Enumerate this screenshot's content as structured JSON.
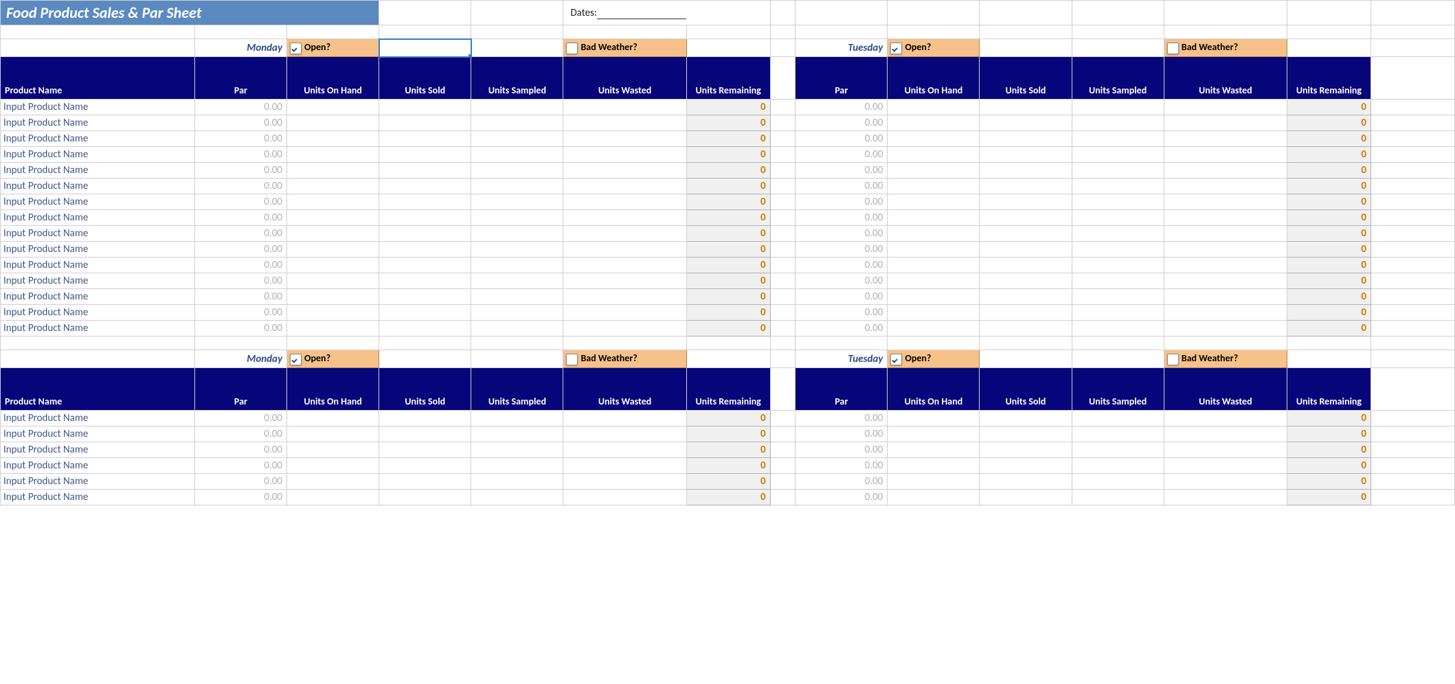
{
  "title": "Food Product Sales & Par Sheet",
  "dates_label": "Dates:",
  "sections": [
    {
      "day1": "Monday",
      "day2": "Tuesday",
      "open_label": "Open?",
      "bad_weather_label": "Bad Weather?",
      "open1_checked": true,
      "bad1_checked": false,
      "open2_checked": true,
      "bad2_checked": false,
      "headers": {
        "product_name": "Product Name",
        "par": "Par",
        "units_on_hand": "Units On Hand",
        "units_sold": "Units Sold",
        "units_sampled": "Units Sampled",
        "units_wasted": "Units Wasted",
        "units_remaining": "Units Remaining"
      },
      "rows": [
        {
          "product": "Input Product Name",
          "par1": "0.00",
          "remain1": "0",
          "par2": "0.00",
          "remain2": "0"
        },
        {
          "product": "Input Product Name",
          "par1": "0.00",
          "remain1": "0",
          "par2": "0.00",
          "remain2": "0"
        },
        {
          "product": "Input Product Name",
          "par1": "0.00",
          "remain1": "0",
          "par2": "0.00",
          "remain2": "0"
        },
        {
          "product": "Input Product Name",
          "par1": "0.00",
          "remain1": "0",
          "par2": "0.00",
          "remain2": "0"
        },
        {
          "product": "Input Product Name",
          "par1": "0.00",
          "remain1": "0",
          "par2": "0.00",
          "remain2": "0"
        },
        {
          "product": "Input Product Name",
          "par1": "0.00",
          "remain1": "0",
          "par2": "0.00",
          "remain2": "0"
        },
        {
          "product": "Input Product Name",
          "par1": "0.00",
          "remain1": "0",
          "par2": "0.00",
          "remain2": "0"
        },
        {
          "product": "Input Product Name",
          "par1": "0.00",
          "remain1": "0",
          "par2": "0.00",
          "remain2": "0"
        },
        {
          "product": "Input Product Name",
          "par1": "0.00",
          "remain1": "0",
          "par2": "0.00",
          "remain2": "0"
        },
        {
          "product": "Input Product Name",
          "par1": "0.00",
          "remain1": "0",
          "par2": "0.00",
          "remain2": "0"
        },
        {
          "product": "Input Product Name",
          "par1": "0.00",
          "remain1": "0",
          "par2": "0.00",
          "remain2": "0"
        },
        {
          "product": "Input Product Name",
          "par1": "0.00",
          "remain1": "0",
          "par2": "0.00",
          "remain2": "0"
        },
        {
          "product": "Input Product Name",
          "par1": "0.00",
          "remain1": "0",
          "par2": "0.00",
          "remain2": "0"
        },
        {
          "product": "Input Product Name",
          "par1": "0.00",
          "remain1": "0",
          "par2": "0.00",
          "remain2": "0"
        },
        {
          "product": "Input Product Name",
          "par1": "0.00",
          "remain1": "0",
          "par2": "0.00",
          "remain2": "0"
        }
      ]
    },
    {
      "day1": "Monday",
      "day2": "Tuesday",
      "open_label": "Open?",
      "bad_weather_label": "Bad Weather?",
      "open1_checked": true,
      "bad1_checked": false,
      "open2_checked": true,
      "bad2_checked": false,
      "headers": {
        "product_name": "Product Name",
        "par": "Par",
        "units_on_hand": "Units On Hand",
        "units_sold": "Units Sold",
        "units_sampled": "Units Sampled",
        "units_wasted": "Units Wasted",
        "units_remaining": "Units Remaining"
      },
      "rows": [
        {
          "product": "Input Product Name",
          "par1": "0.00",
          "remain1": "0",
          "par2": "0.00",
          "remain2": "0"
        },
        {
          "product": "Input Product Name",
          "par1": "0.00",
          "remain1": "0",
          "par2": "0.00",
          "remain2": "0"
        },
        {
          "product": "Input Product Name",
          "par1": "0.00",
          "remain1": "0",
          "par2": "0.00",
          "remain2": "0"
        },
        {
          "product": "Input Product Name",
          "par1": "0.00",
          "remain1": "0",
          "par2": "0.00",
          "remain2": "0"
        },
        {
          "product": "Input Product Name",
          "par1": "0.00",
          "remain1": "0",
          "par2": "0.00",
          "remain2": "0"
        },
        {
          "product": "Input Product Name",
          "par1": "0.00",
          "remain1": "0",
          "par2": "0.00",
          "remain2": "0"
        }
      ]
    }
  ]
}
